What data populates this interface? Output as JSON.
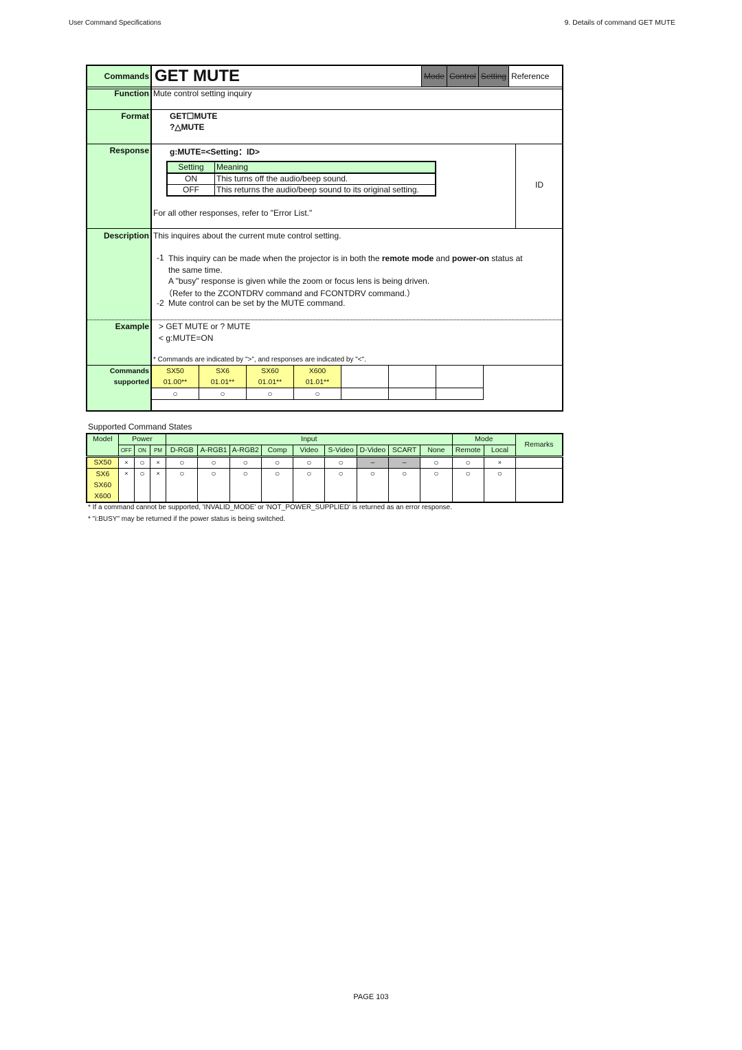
{
  "page": {
    "header_left": "User Command Specifications",
    "header_right": "9. Details of command  GET MUTE",
    "footer": "PAGE 103"
  },
  "card": {
    "commands_label": "Commands",
    "title": "GET MUTE",
    "reference_tabs": [
      {
        "label": "Mode",
        "active": false
      },
      {
        "label": "Control",
        "active": false
      },
      {
        "label": "Setting",
        "active": false
      },
      {
        "label": "Reference",
        "active": true
      }
    ],
    "function": {
      "label": "Function",
      "text": "Mute control setting inquiry"
    },
    "format": {
      "label": "Format",
      "lines": [
        "GET☐MUTE",
        "?△MUTE"
      ]
    },
    "response": {
      "label": "Response",
      "syntax": "g:MUTE=<Setting：ID>",
      "table": {
        "headers": [
          "Setting",
          "Meaning"
        ],
        "rows": [
          [
            "ON",
            "This turns off the audio/beep sound."
          ],
          [
            "OFF",
            "This returns the audio/beep sound to its original setting."
          ]
        ]
      },
      "note": "For all other responses, refer to \"Error List.\"",
      "id_label": "ID"
    },
    "description": {
      "label": "Description",
      "summary": "This inquires about the current mute control setting.",
      "item1_num": "-1",
      "item1_pre": "This inquiry can be made when the projector is in both the ",
      "item1_bold1": "remote mode",
      "item1_mid": " and ",
      "item1_bold2": "power-on",
      "item1_post": " status at",
      "item1_line2": "the same time.",
      "item1_line3": "A \"busy\" response is given while the zoom or focus lens is being driven.",
      "item1_line4": "（Refer to the ZCONTDRV command and FCONTDRV command.）",
      "item2_num": "-2",
      "item2_text": "Mute control can be set by the MUTE command."
    },
    "example": {
      "label": "Example",
      "lines": [
        "> GET MUTE or ? MUTE",
        "< g:MUTE=ON"
      ],
      "footnote": "* Commands are indicated by \">\", and responses are indicated by \"<\"."
    },
    "commands_supported": {
      "label_line1": "Commands",
      "label_line2": "supported",
      "models": [
        "SX50",
        "SX6",
        "SX60",
        "X600",
        "",
        "",
        ""
      ],
      "versions": [
        "01.00**",
        "01.01**",
        "01.01**",
        "01.01**",
        "",
        "",
        ""
      ],
      "marks": [
        "○",
        "○",
        "○",
        "○",
        "",
        "",
        ""
      ]
    }
  },
  "states": {
    "title": "Supported Command States",
    "group_headers": {
      "model": "Model",
      "power": "Power",
      "input": "Input",
      "mode": "Mode",
      "remarks": "Remarks"
    },
    "power_cols": [
      "OFF",
      "ON",
      "PM"
    ],
    "input_cols": [
      "D-RGB",
      "A-RGB1",
      "A-RGB2",
      "Comp",
      "Video",
      "S-Video",
      "D-Video",
      "SCART",
      "None"
    ],
    "mode_cols": [
      "Remote",
      "Local"
    ],
    "rows": [
      {
        "models": [
          "SX50"
        ],
        "power": [
          "×",
          "○",
          "×"
        ],
        "input": [
          "○",
          "○",
          "○",
          "○",
          "○",
          "○",
          "–",
          "–",
          "○"
        ],
        "mode": [
          "○",
          "×"
        ],
        "remarks": ""
      },
      {
        "models": [
          "SX6",
          "SX60",
          "X600"
        ],
        "power": [
          "×",
          "○",
          "×"
        ],
        "input": [
          "○",
          "○",
          "○",
          "○",
          "○",
          "○",
          "○",
          "○",
          "○"
        ],
        "mode": [
          "○",
          "○"
        ],
        "remarks": ""
      }
    ],
    "notes": [
      "* If a command cannot be supported, 'INVALID_MODE' or 'NOT_POWER_SUPPLIED' is returned as an error response.",
      "* \"i:BUSY\" may be returned if the power status is being switched."
    ]
  },
  "colors": {
    "label_green": "#ccffcc",
    "model_yellow": "#ffff99",
    "tab_gray": "#808080",
    "na_gray": "#c0c0c0"
  }
}
